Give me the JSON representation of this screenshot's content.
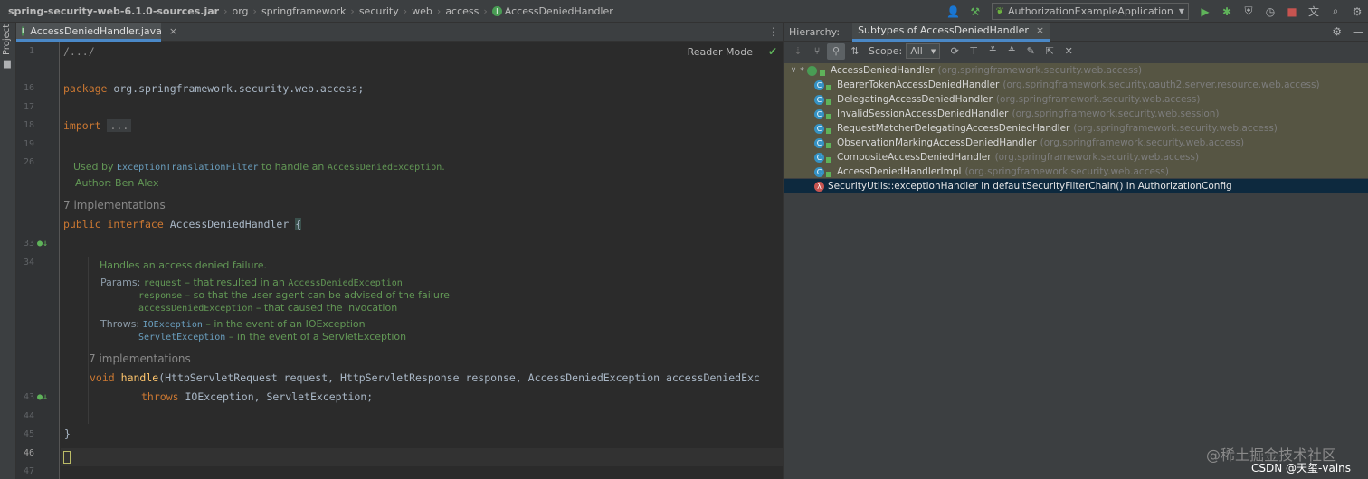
{
  "breadcrumb": {
    "items": [
      "spring-security-web-6.1.0-sources.jar",
      "org",
      "springframework",
      "security",
      "web",
      "access",
      "AccessDeniedHandler"
    ]
  },
  "run_config": {
    "label": "AuthorizationExampleApplication"
  },
  "sidebar": {
    "project_label": "Project"
  },
  "editor": {
    "tab_label": "AccessDeniedHandler.java",
    "reader_mode": "Reader Mode",
    "line_numbers": [
      "1",
      "16",
      "17",
      "18",
      "19",
      "26",
      "33",
      "34",
      "43",
      "44",
      "45",
      "46",
      "47"
    ],
    "lines": {
      "fold_header": "/.../",
      "package_kw": "package",
      "package_name": " org.springframework.security.web.access;",
      "import_kw": "import",
      "import_fold": "...",
      "iface_kw": "public interface",
      "iface_name": " AccessDeniedHandler ",
      "iface_brace": "{",
      "method_kw": "void",
      "method_name": "handle",
      "method_params": "(HttpServletRequest request, HttpServletResponse response, AccessDeniedException accessDeniedExc",
      "throws_kw": "throws",
      "throws_list": " IOException, ServletException;",
      "close_brace": "}"
    },
    "class_doc": {
      "used_by_prefix": "Used by ",
      "used_by_ref": "ExceptionTranslationFilter",
      "used_by_mid": " to handle an ",
      "used_by_ref2": "AccessDeniedException",
      "used_by_end": ".",
      "author": "Author: Ben Alex"
    },
    "class_impls": "7 implementations",
    "method_doc": {
      "summary": "Handles an access denied failure.",
      "params_label": "Params:",
      "p1_name": "request",
      "p1_text": " – that resulted in an ",
      "p1_ref": "AccessDeniedException",
      "p2_name": "response",
      "p2_text": " – so that the user agent can be advised of the failure",
      "p3_name": "accessDeniedException",
      "p3_text": " – that caused the invocation",
      "throws_label": "Throws:",
      "t1_name": "IOException",
      "t1_text": " – in the event of an IOException",
      "t2_name": "ServletException",
      "t2_text": " – in the event of a ServletException"
    },
    "method_impls": "7 implementations"
  },
  "hierarchy": {
    "title": "Hierarchy:",
    "tab_label": "Subtypes of AccessDeniedHandler",
    "scope_label": "Scope:",
    "scope_value": "All",
    "root": {
      "name": "AccessDeniedHandler",
      "pkg": "(org.springframework.security.web.access)"
    },
    "children": [
      {
        "name": "BearerTokenAccessDeniedHandler",
        "pkg": "(org.springframework.security.oauth2.server.resource.web.access)"
      },
      {
        "name": "DelegatingAccessDeniedHandler",
        "pkg": "(org.springframework.security.web.access)"
      },
      {
        "name": "InvalidSessionAccessDeniedHandler",
        "pkg": "(org.springframework.security.web.session)"
      },
      {
        "name": "RequestMatcherDelegatingAccessDeniedHandler",
        "pkg": "(org.springframework.security.web.access)"
      },
      {
        "name": "ObservationMarkingAccessDeniedHandler",
        "pkg": "(org.springframework.security.web.access)"
      },
      {
        "name": "CompositeAccessDeniedHandler",
        "pkg": "(org.springframework.security.web.access)"
      },
      {
        "name": "AccessDeniedHandlerImpl",
        "pkg": "(org.springframework.security.web.access)"
      }
    ],
    "lambda": {
      "name": "SecurityUtils::exceptionHandler in defaultSecurityFilterChain() in AuthorizationConfig"
    }
  },
  "watermark": {
    "line1": "@稀土掘金技术社区",
    "line2": "CSDN @天玺-vains"
  },
  "colors": {
    "accent": "#4a88c7",
    "selection": "#0d293e",
    "keyword": "#cc7832",
    "doc": "#629755"
  }
}
